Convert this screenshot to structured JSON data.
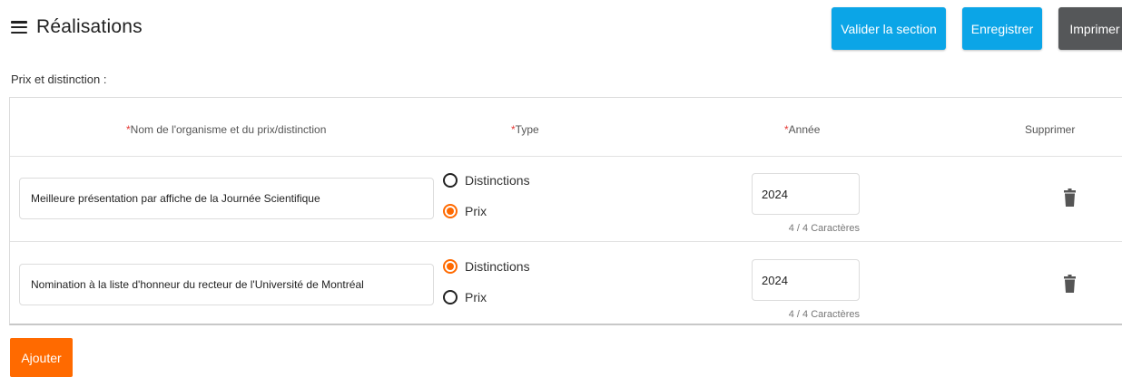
{
  "header": {
    "title": "Réalisations",
    "buttons": {
      "validate": "Valider la section",
      "save": "Enregistrer",
      "print": "Imprimer"
    }
  },
  "section": {
    "label": "Prix et distinction :"
  },
  "table": {
    "columns": {
      "required_mark": "*",
      "name": "Nom de l'organisme et du prix/distinction",
      "type": "Type",
      "year": "Année",
      "delete": "Supprimer"
    },
    "type_options": [
      "Distinctions",
      "Prix"
    ],
    "rows": [
      {
        "name": "Meilleure présentation par affiche de la Journée Scientifique",
        "selected_type": "Prix",
        "year": "2024",
        "char_count": "4 / 4 Caractères"
      },
      {
        "name": "Nomination à la liste d'honneur du recteur de l'Université de Montréal",
        "selected_type": "Distinctions",
        "year": "2024",
        "char_count": "4 / 4 Caractères"
      }
    ]
  },
  "add_button": "Ajouter",
  "icons": {
    "menu": "hamburger-menu-icon",
    "delete": "trash-icon",
    "radio": "radio-button-icon"
  },
  "colors": {
    "primary_button": "#0ba5e7",
    "print_button": "#555759",
    "accent": "#ff6a00",
    "required": "#e53935"
  }
}
